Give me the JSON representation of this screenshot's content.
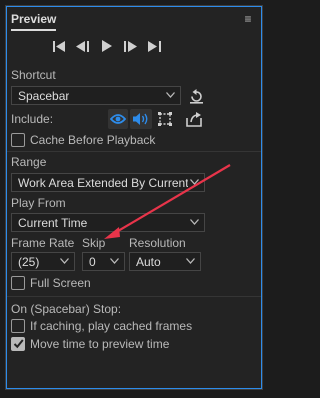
{
  "panel": {
    "title": "Preview",
    "menu_glyph": "≡"
  },
  "transport": {
    "buttons": [
      "go-to-first-frame-icon",
      "step-back-icon",
      "play-icon",
      "step-forward-icon",
      "go-to-last-frame-icon"
    ]
  },
  "shortcut": {
    "label": "Shortcut",
    "value": "Spacebar"
  },
  "include": {
    "label": "Include:",
    "icons": [
      "video-eye-icon",
      "audio-speaker-icon",
      "overlays-icon",
      "layer-controls-icon"
    ]
  },
  "cache_before_playback": {
    "label": "Cache Before Playback",
    "checked": false
  },
  "range": {
    "label": "Range",
    "value": "Work Area Extended By Current ..."
  },
  "play_from": {
    "label": "Play From",
    "value": "Current Time"
  },
  "frame_rate": {
    "label": "Frame Rate",
    "value": "(25)"
  },
  "skip": {
    "label": "Skip",
    "value": "0"
  },
  "resolution": {
    "label": "Resolution",
    "value": "Auto"
  },
  "full_screen": {
    "label": "Full Screen",
    "checked": false
  },
  "on_stop": {
    "label": "On (Spacebar) Stop:",
    "play_cached": {
      "label": "If caching, play cached frames",
      "checked": false
    },
    "move_time": {
      "label": "Move time to preview time",
      "checked": true
    }
  },
  "annotation": {
    "arrow_color": "#e8344a"
  },
  "colors": {
    "accent_blue": "#2d8ceb",
    "panel_bg": "#232323"
  }
}
